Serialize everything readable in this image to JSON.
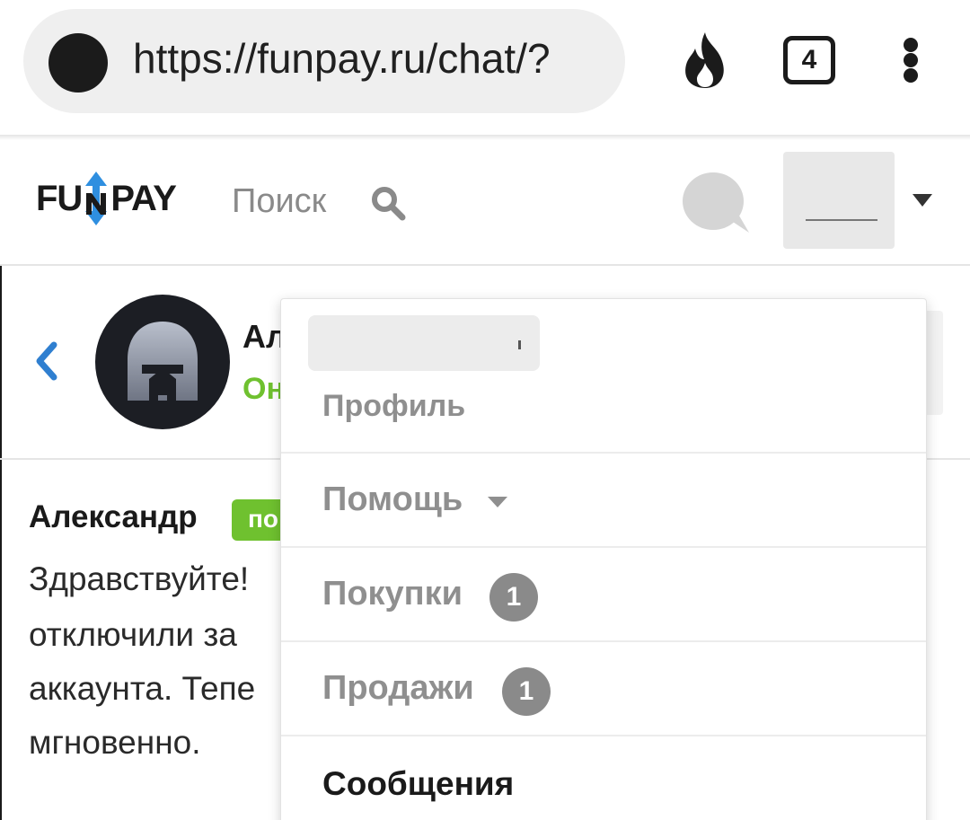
{
  "browser": {
    "url": "https://funpay.ru/chat/?",
    "tab_count": "4",
    "icons": [
      "site-favicon-icon",
      "fire-icon",
      "tabs-icon",
      "more-vert-icon"
    ]
  },
  "site_header": {
    "logo_text_left": "FU",
    "logo_text_right": "PAY",
    "search_label": "Поиск",
    "icons": [
      "search-icon",
      "chat-bubble-icon",
      "caret-down-icon"
    ]
  },
  "chat_header": {
    "name_visible": "Ал",
    "status_visible": "Он"
  },
  "message": {
    "author": "Александр",
    "badge_visible": "по",
    "lines": [
      "Здравствуйте!",
      "отключили за",
      "аккаунта. Тепе",
      "мгновенно."
    ]
  },
  "dropdown": {
    "items": [
      {
        "label": "Профиль"
      },
      {
        "label": "Помощь"
      },
      {
        "label": "Покупки",
        "count": "1"
      },
      {
        "label": "Продажи",
        "count": "1"
      },
      {
        "label": "Сообщения"
      }
    ]
  },
  "colors": {
    "accent_green": "#6fc12f",
    "badge_gray": "#8a8a8a",
    "logo_blue": "#2f8fe0"
  }
}
